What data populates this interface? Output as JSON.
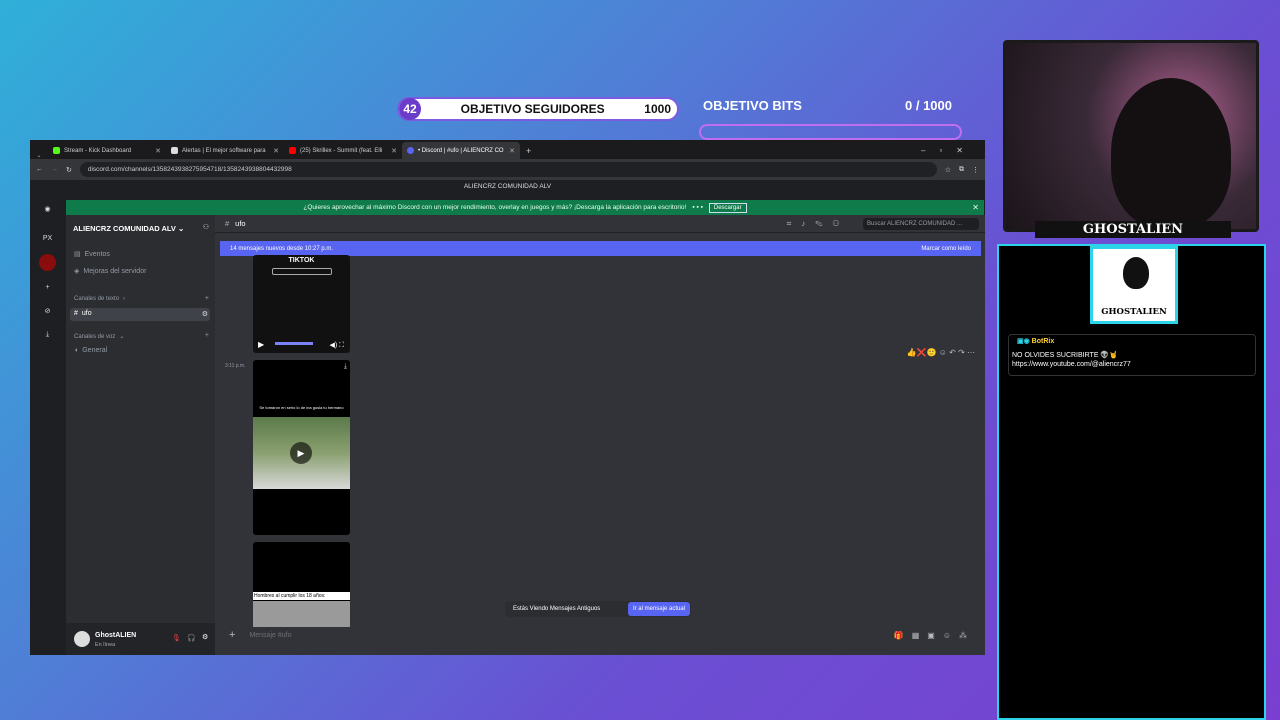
{
  "overlay": {
    "followers_current": "42",
    "followers_title": "OBJETIVO SEGUIDORES",
    "followers_goal": "1000",
    "bits_title": "OBJETIVO BITS",
    "bits_count": "0 / 1000",
    "streamer_name": "GHOSTALIEN",
    "logo_text": "GHOSTALIEN"
  },
  "browser": {
    "tabs": [
      {
        "label": "Stream - Kick Dashboard",
        "color": "#53fc18"
      },
      {
        "label": "Alertas | El mejor software para",
        "color": "#dddddd"
      },
      {
        "label": "(25) Skrillex - Summit (feat. Elli",
        "color": "#ff0000"
      },
      {
        "label": "• Discord | #ufo | ALIENCRZ CO",
        "color": "#5865f2"
      }
    ],
    "url": "discord.com/channels/1358243938275954718/1358243938804432998"
  },
  "discord": {
    "window_title": "ALIENCRZ COMUNIDAD ALV",
    "notice": "¿Quieres aprovechar al máximo Discord con un mejor rendimiento, overlay en juegos y más? ¡Descarga la aplicación para escritorio!",
    "notice_button": "Descargar",
    "rail": [
      "PX"
    ],
    "server_name": "ALIENCRZ COMUNIDAD ALV",
    "events": "Eventos",
    "boosts": "Mejoras del servidor",
    "text_category": "Canales de texto",
    "voice_category": "Canales de voz",
    "channel_selected": "ufo",
    "voice_channel": "General",
    "user_name": "GhostALIEN",
    "user_status": "En línea",
    "header_channel": "ufo",
    "search_placeholder": "Buscar ALIENCRZ COMUNIDAD ...",
    "new_messages": "14 mensajes nuevos desde 10:27 p.m.",
    "mark_read": "Marcar como leído",
    "video1_title": "TIKTOK",
    "timestamp": "3:11 p.m.",
    "video2_caption": "Se tomaron en serio lo de ina gusla tu hermano",
    "video3_caption": "Hombres al cumplir los 18 años:",
    "old_messages": "Estás Viendo Mensajes Antiguos",
    "jump_button": "Ir al mensaje actual",
    "compose_placeholder": "Mensaje #ufo"
  },
  "chat": {
    "username": "BotRix",
    "line1": "NO OLVIDES SUCRIBIRTE 👽🤘",
    "line2": "https://www.youtube.com/@aliencrz77"
  }
}
